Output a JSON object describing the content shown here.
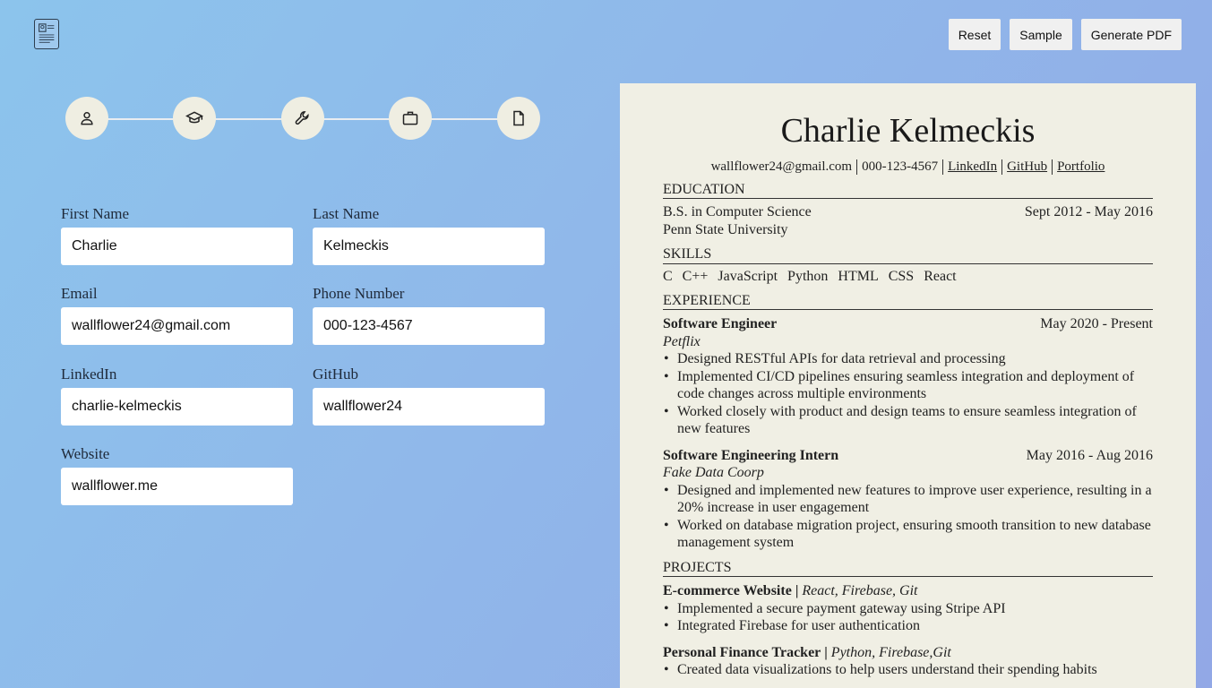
{
  "toolbar": {
    "reset_label": "Reset",
    "sample_label": "Sample",
    "generate_label": "Generate PDF"
  },
  "stepper": {
    "steps": [
      {
        "icon": "user-icon"
      },
      {
        "icon": "graduation-cap-icon"
      },
      {
        "icon": "wrench-icon"
      },
      {
        "icon": "briefcase-icon"
      },
      {
        "icon": "document-icon"
      }
    ]
  },
  "form": {
    "first_name": {
      "label": "First Name",
      "value": "Charlie"
    },
    "last_name": {
      "label": "Last Name",
      "value": "Kelmeckis"
    },
    "email": {
      "label": "Email",
      "value": "wallflower24@gmail.com"
    },
    "phone": {
      "label": "Phone Number",
      "value": "000-123-4567"
    },
    "linkedin": {
      "label": "LinkedIn",
      "value": "charlie-kelmeckis"
    },
    "github": {
      "label": "GitHub",
      "value": "wallflower24"
    },
    "website": {
      "label": "Website",
      "value": "wallflower.me"
    }
  },
  "resume": {
    "name": "Charlie Kelmeckis",
    "email": "wallflower24@gmail.com",
    "phone": "000-123-4567",
    "linkedin": "LinkedIn",
    "github": "GitHub",
    "portfolio": "Portfolio",
    "education_heading": "EDUCATION",
    "education": {
      "degree": "B.S. in Computer Science",
      "dates": "Sept 2012 - May 2016",
      "school": "Penn State University"
    },
    "skills_heading": "SKILLS",
    "skills": [
      "C",
      "C++",
      "JavaScript",
      "Python",
      "HTML",
      "CSS",
      "React"
    ],
    "experience_heading": "EXPERIENCE",
    "experience": [
      {
        "title": "Software Engineer",
        "dates": "May 2020 - Present",
        "company": "Petflix",
        "bullets": [
          "Designed RESTful APIs for data retrieval and processing",
          "Implemented CI/CD pipelines ensuring seamless integration and deployment of code changes across multiple environments",
          "Worked closely with product and design teams to ensure seamless integration of new features"
        ]
      },
      {
        "title": "Software Engineering Intern",
        "dates": "May 2016 - Aug 2016",
        "company": "Fake Data Coorp",
        "bullets": [
          "Designed and implemented new features to improve user experience, resulting in a 20% increase in user engagement",
          "Worked on database migration project, ensuring smooth transition to new database management system"
        ]
      }
    ],
    "projects_heading": "PROJECTS",
    "projects": [
      {
        "name": "E-commerce Website",
        "separator": " | ",
        "tech": "React, Firebase, Git",
        "bullets": [
          "Implemented a secure payment gateway using Stripe API",
          "Integrated Firebase for user authentication"
        ]
      },
      {
        "name": "Personal Finance Tracker",
        "separator": " | ",
        "tech": "Python, Firebase,Git",
        "bullets": [
          "Created data visualizations to help users understand their spending habits"
        ]
      }
    ]
  }
}
